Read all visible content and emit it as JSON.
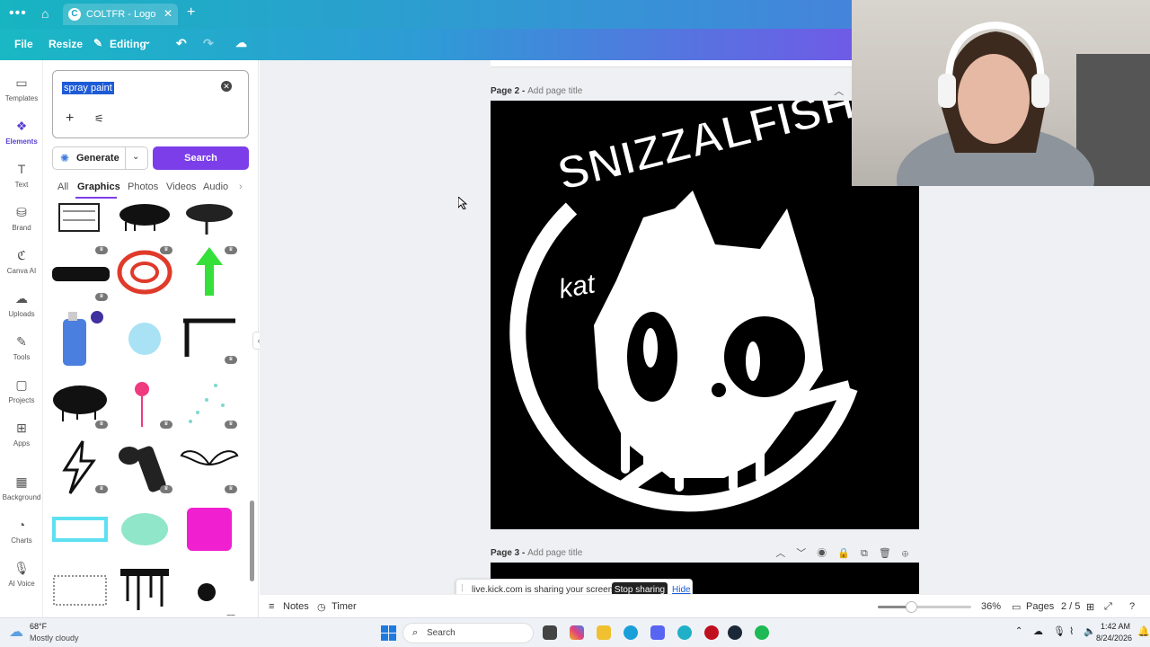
{
  "browser": {
    "tab_title": "COLTFR - Logo",
    "tab_favicon": "C"
  },
  "toolbar": {
    "file": "File",
    "resize": "Resize",
    "editing": "Editing"
  },
  "rail": [
    {
      "label": "Templates",
      "icon": "templates-icon"
    },
    {
      "label": "Elements",
      "icon": "elements-icon"
    },
    {
      "label": "Text",
      "icon": "text-icon"
    },
    {
      "label": "Brand",
      "icon": "brand-icon"
    },
    {
      "label": "Canva AI",
      "icon": "canva-ai-icon"
    },
    {
      "label": "Uploads",
      "icon": "uploads-icon"
    },
    {
      "label": "Tools",
      "icon": "tools-icon"
    },
    {
      "label": "Projects",
      "icon": "projects-icon"
    },
    {
      "label": "Apps",
      "icon": "apps-icon"
    },
    {
      "label": "Background",
      "icon": "background-icon"
    },
    {
      "label": "Charts",
      "icon": "charts-icon"
    },
    {
      "label": "AI Voice",
      "icon": "ai-voice-icon"
    }
  ],
  "panel": {
    "search_value": "spray paint",
    "generate_label": "Generate",
    "search_label": "Search",
    "categories": [
      "All",
      "Graphics",
      "Photos",
      "Videos",
      "Audio"
    ]
  },
  "pages": {
    "page2_title": "Page 2 -",
    "page2_add": "Add page title",
    "page3_title": "Page 3 -",
    "page3_add": "Add page title"
  },
  "logo": {
    "text": "SNIZZALFISH",
    "tag": "kat"
  },
  "share_banner": {
    "text": "live.kick.com is sharing your screen.",
    "stop": "Stop sharing",
    "hide": "Hide"
  },
  "footer": {
    "notes": "Notes",
    "timer": "Timer",
    "zoom": "36%",
    "pages": "Pages",
    "page_count": "2 / 5",
    "zoom_fraction": 0.36
  },
  "taskbar": {
    "weather_temp": "68°F",
    "weather_desc": "Mostly cloudy",
    "search": "Search",
    "time": "1:42 AM",
    "date": "8/24/2026"
  },
  "colors": {
    "accent": "#7b3ee8",
    "brand_gradient_start": "#17b4c2",
    "brand_gradient_end": "#6f5be6"
  }
}
